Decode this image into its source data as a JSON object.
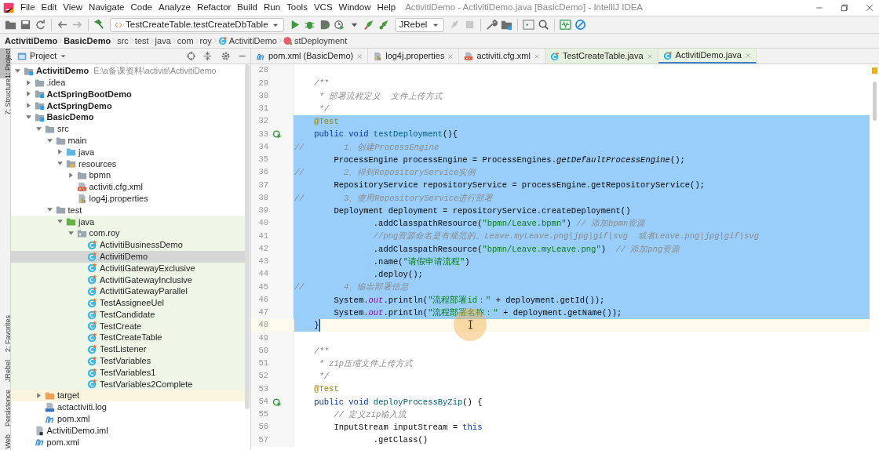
{
  "window": {
    "title": "ActivitiDemo - ActivitiDemo.java [BasicDemo] - IntelliJ IDEA"
  },
  "menu": [
    "File",
    "Edit",
    "View",
    "Navigate",
    "Code",
    "Analyze",
    "Refactor",
    "Build",
    "Run",
    "Tools",
    "VCS",
    "Window",
    "Help"
  ],
  "toolbar": {
    "run_config": "TestCreateTable.testCreateDbTable",
    "jrebel_config": "JRebel"
  },
  "breadcrumbs": [
    {
      "label": "ActivitiDemo",
      "kind": "module"
    },
    {
      "label": "BasicDemo",
      "kind": "module"
    },
    {
      "label": "src",
      "kind": "dir"
    },
    {
      "label": "test",
      "kind": "dir"
    },
    {
      "label": "java",
      "kind": "dir"
    },
    {
      "label": "com",
      "kind": "dir"
    },
    {
      "label": "roy",
      "kind": "dir"
    },
    {
      "label": "ActivitiDemo",
      "kind": "class"
    },
    {
      "label": "stDeployment",
      "kind": "method"
    }
  ],
  "tool_strip": {
    "top": [
      {
        "label": "1: Project",
        "selected": true
      },
      {
        "label": "7: Structure",
        "selected": false
      }
    ],
    "bottom": [
      {
        "label": "2: Favorites",
        "selected": false
      },
      {
        "label": "JRebel",
        "selected": false
      },
      {
        "label": "Persistence",
        "selected": false
      },
      {
        "label": "Web",
        "selected": false
      }
    ]
  },
  "project_panel": {
    "title": "Project",
    "tree": [
      {
        "label": "ActivitiDemo",
        "kind": "module",
        "bold": true,
        "hint": "E:\\a备课资料\\activiti\\ActivitiDemo",
        "expanded": true,
        "selected": false,
        "children": [
          {
            "label": ".idea",
            "kind": "folder",
            "expanded": false,
            "selected": false
          },
          {
            "label": "ActSpringBootDemo",
            "kind": "module",
            "bold": true,
            "expanded": false,
            "selected": false
          },
          {
            "label": "ActSpringDemo",
            "kind": "module",
            "bold": true,
            "expanded": false,
            "selected": false
          },
          {
            "label": "BasicDemo",
            "kind": "module",
            "bold": true,
            "expanded": true,
            "selected": false,
            "children": [
              {
                "label": "src",
                "kind": "folder",
                "expanded": true,
                "selected": false,
                "children": [
                  {
                    "label": "main",
                    "kind": "folder",
                    "expanded": true,
                    "selected": false,
                    "children": [
                      {
                        "label": "java",
                        "kind": "source",
                        "expanded": false,
                        "selected": false
                      },
                      {
                        "label": "resources",
                        "kind": "resources",
                        "expanded": true,
                        "selected": false,
                        "children": [
                          {
                            "label": "bpmn",
                            "kind": "folder",
                            "expanded": false,
                            "selected": false
                          },
                          {
                            "label": "activiti.cfg.xml",
                            "kind": "xml",
                            "selected": false
                          },
                          {
                            "label": "log4j.properties",
                            "kind": "properties",
                            "selected": false
                          }
                        ]
                      }
                    ]
                  },
                  {
                    "label": "test",
                    "kind": "folder",
                    "expanded": true,
                    "selected": false,
                    "children": [
                      {
                        "label": "java",
                        "kind": "testsource",
                        "test_scope": true,
                        "expanded": true,
                        "selected": false,
                        "children": [
                          {
                            "label": "com.roy",
                            "kind": "package",
                            "test_scope": true,
                            "expanded": true,
                            "selected": false,
                            "children": [
                              {
                                "label": "ActivitiBusinessDemo",
                                "kind": "class",
                                "test_scope": true,
                                "selected": false
                              },
                              {
                                "label": "ActivitiDemo",
                                "kind": "class",
                                "test_scope": true,
                                "selected": true
                              },
                              {
                                "label": "ActivitiGatewayExclusive",
                                "kind": "class",
                                "test_scope": true,
                                "selected": false
                              },
                              {
                                "label": "ActivitiGatewayInclusive",
                                "kind": "class",
                                "test_scope": true,
                                "selected": false
                              },
                              {
                                "label": "ActivitiGatewayParallel",
                                "kind": "class",
                                "test_scope": true,
                                "selected": false
                              },
                              {
                                "label": "TestAssigneeUel",
                                "kind": "class",
                                "test_scope": true,
                                "selected": false
                              },
                              {
                                "label": "TestCandidate",
                                "kind": "class",
                                "test_scope": true,
                                "selected": false
                              },
                              {
                                "label": "TestCreate",
                                "kind": "class",
                                "test_scope": true,
                                "selected": false
                              },
                              {
                                "label": "TestCreateTable",
                                "kind": "class",
                                "test_scope": true,
                                "selected": false
                              },
                              {
                                "label": "TestListener",
                                "kind": "class",
                                "test_scope": true,
                                "selected": false
                              },
                              {
                                "label": "TestVariables",
                                "kind": "class",
                                "test_scope": true,
                                "selected": false
                              },
                              {
                                "label": "TestVariables1",
                                "kind": "class",
                                "test_scope": true,
                                "selected": false
                              },
                              {
                                "label": "TestVariables2Complete",
                                "kind": "class",
                                "test_scope": true,
                                "selected": false
                              }
                            ]
                          }
                        ]
                      }
                    ]
                  }
                ]
              },
              {
                "label": "target",
                "kind": "excluded",
                "excluded": true,
                "expanded": false,
                "selected": false
              },
              {
                "label": "actactiviti.log",
                "kind": "log",
                "selected": false
              },
              {
                "label": "pom.xml",
                "kind": "maven",
                "selected": false
              }
            ]
          },
          {
            "label": "ActivitiDemo.iml",
            "kind": "iml",
            "selected": false
          },
          {
            "label": "pom.xml",
            "kind": "maven",
            "selected": false
          }
        ]
      }
    ]
  },
  "editor": {
    "tabs": [
      {
        "label": "pom.xml (BasicDemo)",
        "kind": "maven",
        "selected": false
      },
      {
        "label": "log4j.properties",
        "kind": "properties",
        "selected": false
      },
      {
        "label": "activiti.cfg.xml",
        "kind": "xml",
        "selected": false
      },
      {
        "label": "TestCreateTable.java",
        "kind": "class",
        "test_scope": true,
        "selected": false
      },
      {
        "label": "ActivitiDemo.java",
        "kind": "class",
        "test_scope": true,
        "selected": true
      }
    ],
    "lines": [
      {
        "number": "28",
        "selected": false,
        "caret": false,
        "run": false
      },
      {
        "number": "29",
        "selected": false,
        "caret": false,
        "run": false,
        "tokens": [
          {
            "kind": "doc",
            "text": "    /**"
          }
        ]
      },
      {
        "number": "30",
        "selected": false,
        "caret": false,
        "run": false,
        "tokens": [
          {
            "kind": "doc",
            "text": "     * 部署流程定义  文件上传方式"
          }
        ]
      },
      {
        "number": "31",
        "selected": false,
        "caret": false,
        "run": false,
        "tokens": [
          {
            "kind": "doc",
            "text": "     */"
          }
        ]
      },
      {
        "number": "32",
        "selected": true,
        "caret": false,
        "run": false,
        "tokens": [
          {
            "kind": "annotation",
            "text": "    @Test"
          }
        ]
      },
      {
        "number": "33",
        "selected": true,
        "caret": false,
        "run": true,
        "tokens": [
          {
            "kind": "keyword",
            "text": "    public void "
          },
          {
            "kind": "method",
            "text": "testDeployment"
          },
          {
            "kind": "plain",
            "text": "(){"
          }
        ]
      },
      {
        "number": "34",
        "selected": true,
        "caret": false,
        "run": false,
        "tokens": [
          {
            "kind": "comment",
            "text": "//        1、创建ProcessEngine"
          }
        ]
      },
      {
        "number": "35",
        "selected": true,
        "caret": false,
        "run": false,
        "tokens": [
          {
            "kind": "plain",
            "text": "        ProcessEngine processEngine = ProcessEngines."
          },
          {
            "kind": "static",
            "text": "getDefaultProcessEngine"
          },
          {
            "kind": "plain",
            "text": "();"
          }
        ]
      },
      {
        "number": "36",
        "selected": true,
        "caret": false,
        "run": false,
        "tokens": [
          {
            "kind": "comment",
            "text": "//        2、得到RepositoryService实例"
          }
        ]
      },
      {
        "number": "37",
        "selected": true,
        "caret": false,
        "run": false,
        "tokens": [
          {
            "kind": "plain",
            "text": "        RepositoryService repositoryService = processEngine.getRepositoryService();"
          }
        ]
      },
      {
        "number": "38",
        "selected": true,
        "caret": false,
        "run": false,
        "tokens": [
          {
            "kind": "comment",
            "text": "//        3、使用RepositoryService进行部署"
          }
        ]
      },
      {
        "number": "39",
        "selected": true,
        "caret": false,
        "run": false,
        "tokens": [
          {
            "kind": "plain",
            "text": "        Deployment deployment = repositoryService.createDeployment()"
          }
        ]
      },
      {
        "number": "40",
        "selected": true,
        "caret": false,
        "run": false,
        "tokens": [
          {
            "kind": "plain",
            "text": "                .addClasspathResource("
          },
          {
            "kind": "string",
            "text": "\"bpmn/Leave.bpmn\""
          },
          {
            "kind": "plain",
            "text": ") "
          },
          {
            "kind": "comment",
            "text": "// 添加bpmn资源"
          }
        ]
      },
      {
        "number": "41",
        "selected": true,
        "caret": false,
        "run": false,
        "tokens": [
          {
            "kind": "comment",
            "text": "                //png资源命名是有规范的。Leave.myLeave.png|jpg|gif|svg  或者Leave.png|jpg|gif|svg"
          }
        ]
      },
      {
        "number": "42",
        "selected": true,
        "caret": false,
        "run": false,
        "tokens": [
          {
            "kind": "plain",
            "text": "                .addClasspathResource("
          },
          {
            "kind": "string",
            "text": "\"bpmn/Leave.myLeave.png\""
          },
          {
            "kind": "plain",
            "text": ")  "
          },
          {
            "kind": "comment",
            "text": "// 添加png资源"
          }
        ]
      },
      {
        "number": "43",
        "selected": true,
        "caret": false,
        "run": false,
        "tokens": [
          {
            "kind": "plain",
            "text": "                .name("
          },
          {
            "kind": "string",
            "text": "\"请假申请流程\""
          },
          {
            "kind": "plain",
            "text": ")"
          }
        ]
      },
      {
        "number": "44",
        "selected": true,
        "caret": false,
        "run": false,
        "tokens": [
          {
            "kind": "plain",
            "text": "                .deploy();"
          }
        ]
      },
      {
        "number": "45",
        "selected": true,
        "caret": false,
        "run": false,
        "tokens": [
          {
            "kind": "comment",
            "text": "//        4、输出部署信息"
          }
        ]
      },
      {
        "number": "46",
        "selected": true,
        "caret": false,
        "run": false,
        "tokens": [
          {
            "kind": "plain",
            "text": "        System."
          },
          {
            "kind": "field",
            "text": "out"
          },
          {
            "kind": "plain",
            "text": ".println("
          },
          {
            "kind": "string",
            "text": "\"流程部署id：\""
          },
          {
            "kind": "plain",
            "text": " + deployment.getId());"
          }
        ]
      },
      {
        "number": "47",
        "selected": true,
        "caret": false,
        "run": false,
        "tokens": [
          {
            "kind": "plain",
            "text": "        System."
          },
          {
            "kind": "field",
            "text": "out"
          },
          {
            "kind": "plain",
            "text": ".println("
          },
          {
            "kind": "string",
            "text": "\"流程部署名称：\""
          },
          {
            "kind": "plain",
            "text": " + deployment.getName());"
          }
        ]
      },
      {
        "number": "48",
        "selected": true,
        "caret": true,
        "run": false,
        "tokens": [
          {
            "kind": "plain",
            "text": "    }"
          }
        ]
      },
      {
        "number": "49",
        "selected": false,
        "caret": false,
        "run": false
      },
      {
        "number": "50",
        "selected": false,
        "caret": false,
        "run": false,
        "tokens": [
          {
            "kind": "doc",
            "text": "    /**"
          }
        ]
      },
      {
        "number": "51",
        "selected": false,
        "caret": false,
        "run": false,
        "tokens": [
          {
            "kind": "doc",
            "text": "     * zip压缩文件上传方式"
          }
        ]
      },
      {
        "number": "52",
        "selected": false,
        "caret": false,
        "run": false,
        "tokens": [
          {
            "kind": "doc",
            "text": "     */"
          }
        ]
      },
      {
        "number": "53",
        "selected": false,
        "caret": false,
        "run": false,
        "tokens": [
          {
            "kind": "annotation",
            "text": "    @Test"
          }
        ]
      },
      {
        "number": "54",
        "selected": false,
        "caret": false,
        "run": true,
        "tokens": [
          {
            "kind": "keyword",
            "text": "    public void "
          },
          {
            "kind": "method",
            "text": "deployProcessByZip"
          },
          {
            "kind": "plain",
            "text": "() {"
          }
        ]
      },
      {
        "number": "55",
        "selected": false,
        "caret": false,
        "run": false,
        "tokens": [
          {
            "kind": "comment",
            "text": "        // 定义zip输入流"
          }
        ]
      },
      {
        "number": "56",
        "selected": false,
        "caret": false,
        "run": false,
        "tokens": [
          {
            "kind": "plain",
            "text": "        InputStream inputStream = "
          },
          {
            "kind": "keyword",
            "text": "this"
          }
        ]
      },
      {
        "number": "57",
        "selected": false,
        "caret": false,
        "run": false,
        "tokens": [
          {
            "kind": "plain",
            "text": "                .getClass()"
          }
        ]
      }
    ]
  }
}
